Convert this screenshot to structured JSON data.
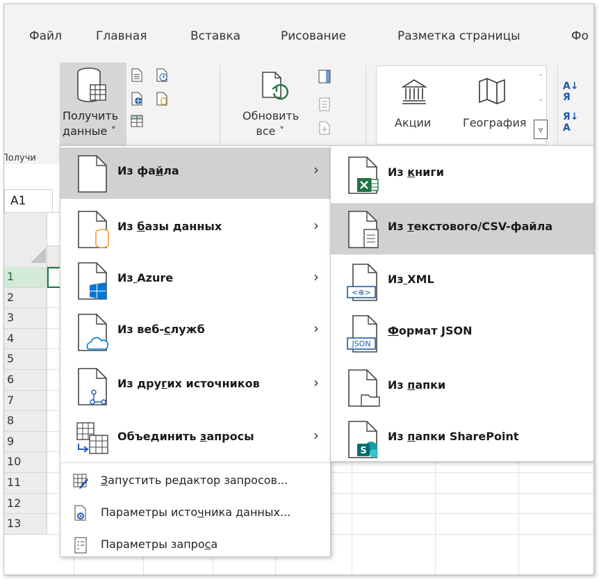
{
  "ribbon": {
    "tabs": [
      "Файл",
      "Главная",
      "Вставка",
      "Рисование",
      "Разметка страницы",
      "Фо"
    ],
    "get_data_label_line1": "Получить",
    "get_data_label_line2": "данные ˅",
    "refresh_label_line1": "Обновить",
    "refresh_label_line2": "все ˅",
    "data_types": [
      "Акции",
      "География"
    ],
    "sort_az": "А\nЯ",
    "sort_za": "Я\nА",
    "group_label": "Получи"
  },
  "sheet": {
    "namebox": "A1",
    "rows": [
      "1",
      "2",
      "3",
      "4",
      "5",
      "6",
      "7",
      "8",
      "9",
      "10",
      "11",
      "12",
      "13"
    ]
  },
  "menu_main": {
    "items": [
      {
        "pre": "Из ",
        "u": "",
        "mid": "фа",
        "u2": "й",
        "post": "ла"
      },
      {
        "pre": "Из ",
        "u": "б",
        "post": "азы данных"
      },
      {
        "pre": "Из",
        "u": " ",
        "post": "Azure"
      },
      {
        "pre": "Из веб-",
        "u": "с",
        "post": "лужб"
      },
      {
        "pre": "Из дру",
        "u": "г",
        "post": "их источников"
      },
      {
        "pre": "Объединить ",
        "u": "з",
        "post": "апросы"
      }
    ],
    "small_items": [
      {
        "pre": "",
        "u": "З",
        "post": "апустить редактор запросов..."
      },
      {
        "pre": "Параметры исто",
        "u": "ч",
        "post": "ника данных..."
      },
      {
        "pre": "Параметры запро",
        "u": "с",
        "post": "а"
      }
    ]
  },
  "menu_sub": {
    "items": [
      {
        "pre": "Из ",
        "u": "к",
        "post": "ниги"
      },
      {
        "pre": "Из ",
        "u": "т",
        "post": "екстового/CSV-файла"
      },
      {
        "pre": "Из",
        "u": " ",
        "post": "XML"
      },
      {
        "pre": "",
        "u": "Ф",
        "post": "ормат JSON"
      },
      {
        "pre": "Из ",
        "u": "п",
        "post": "апки"
      },
      {
        "pre": "Из ",
        "u": "п",
        "post": "апки SharePoint"
      }
    ],
    "icon_text_json": "JSON",
    "icon_text_xml": "<⊕>"
  },
  "colors": {
    "excel_green": "#217346",
    "azure_blue": "#0078d4",
    "orange_db": "#e8a13a",
    "sharepoint_teal": "#036c70"
  }
}
